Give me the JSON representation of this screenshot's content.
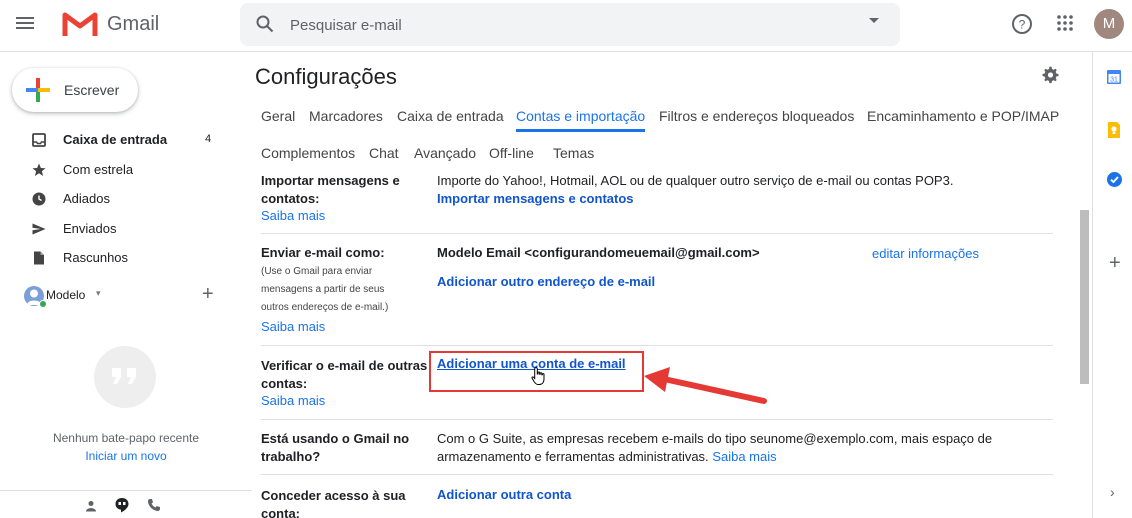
{
  "header": {
    "app_name": "Gmail",
    "search_placeholder": "Pesquisar e-mail",
    "avatar_letter": "M"
  },
  "sidebar": {
    "compose_label": "Escrever",
    "items": [
      {
        "label": "Caixa de entrada",
        "count": "4",
        "icon": "inbox-icon",
        "bold": true
      },
      {
        "label": "Com estrela",
        "count": "",
        "icon": "star-icon"
      },
      {
        "label": "Adiados",
        "count": "",
        "icon": "clock-icon"
      },
      {
        "label": "Enviados",
        "count": "",
        "icon": "send-icon"
      },
      {
        "label": "Rascunhos",
        "count": "",
        "icon": "draft-icon"
      }
    ],
    "hangouts_user": "Modelo",
    "no_chat_text": "Nenhum bate-papo recente",
    "start_new_chat": "Iniciar um novo"
  },
  "settings": {
    "title": "Configurações",
    "tabs": [
      {
        "label": "Geral"
      },
      {
        "label": "Marcadores"
      },
      {
        "label": "Caixa de entrada"
      },
      {
        "label": "Contas e importação",
        "active": true
      },
      {
        "label": "Filtros e endereços bloqueados"
      },
      {
        "label": "Encaminhamento e POP/IMAP"
      },
      {
        "label": "Complementos"
      },
      {
        "label": "Chat"
      },
      {
        "label": "Avançado"
      },
      {
        "label": "Off-line"
      },
      {
        "label": "Temas"
      }
    ],
    "rows": {
      "import": {
        "label_line1": "Importar mensagens e",
        "label_line2": "contatos:",
        "learn_more": "Saiba mais",
        "description": "Importe do Yahoo!, Hotmail, AOL ou de qualquer outro serviço de e-mail ou contas POP3.",
        "action": "Importar mensagens e contatos"
      },
      "send_as": {
        "label": "Enviar e-mail como:",
        "sub_lines": [
          "(Use o Gmail para enviar",
          "mensagens a partir de seus",
          "outros endereços de e-mail.)"
        ],
        "learn_more": "Saiba mais",
        "address": "Modelo Email <configurandomeuemail@gmail.com>",
        "edit": "editar informações",
        "action": "Adicionar outro endereço de e-mail"
      },
      "check_mail": {
        "label_line1": "Verificar o e-mail de outras",
        "label_line2": "contas:",
        "learn_more": "Saiba mais",
        "action": "Adicionar uma conta de e-mail"
      },
      "work": {
        "label_line1": "Está usando o Gmail no",
        "label_line2": "trabalho?",
        "description_line1": "Com o G Suite, as empresas recebem e-mails do tipo seunome@exemplo.com, mais espaço de",
        "description_line2": "armazenamento e ferramentas administrativas.",
        "learn_more": "Saiba mais"
      },
      "grant": {
        "label_line1": "Conceder acesso à sua",
        "label_line2": "conta:",
        "action": "Adicionar outra conta"
      }
    }
  },
  "side_panel": {
    "calendar_day": "31"
  },
  "colors": {
    "accent": "#1a73e8",
    "link": "#1155cc",
    "highlight": "#e53935"
  }
}
